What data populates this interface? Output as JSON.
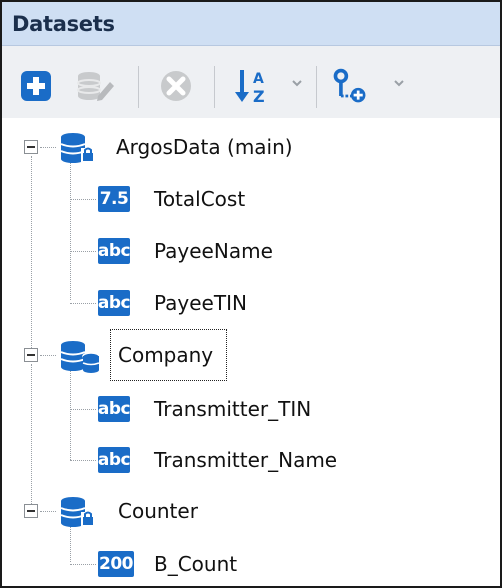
{
  "panel": {
    "title": "Datasets"
  },
  "toolbar": {
    "buttons": [
      {
        "name": "add",
        "icon": "plus-icon",
        "enabled": true
      },
      {
        "name": "edit",
        "icon": "database-edit-icon",
        "enabled": false
      },
      {
        "name": "delete",
        "icon": "close-circle-icon",
        "enabled": false
      },
      {
        "name": "sort",
        "icon": "sort-az-icon",
        "enabled": true
      },
      {
        "name": "connect",
        "icon": "node-add-icon",
        "enabled": true
      }
    ]
  },
  "colors": {
    "header_bg": "#cfdff3",
    "accent": "#1a6cc7",
    "toolbar_bg": "#eef0f3"
  },
  "tree": {
    "datasets": [
      {
        "name": "ArgosData (main)",
        "icon": "database-lock-icon",
        "expanded": true,
        "fields": [
          {
            "type": "7.5",
            "name": "TotalCost"
          },
          {
            "type": "abc",
            "name": "PayeeName"
          },
          {
            "type": "abc",
            "name": "PayeeTIN"
          }
        ]
      },
      {
        "name": "Company",
        "icon": "database-table-icon",
        "expanded": true,
        "selected": true,
        "fields": [
          {
            "type": "abc",
            "name": "Transmitter_TIN"
          },
          {
            "type": "abc",
            "name": "Transmitter_Name"
          }
        ]
      },
      {
        "name": "Counter",
        "icon": "database-lock-icon",
        "expanded": true,
        "fields": [
          {
            "type": "200",
            "name": "B_Count"
          }
        ]
      }
    ]
  }
}
